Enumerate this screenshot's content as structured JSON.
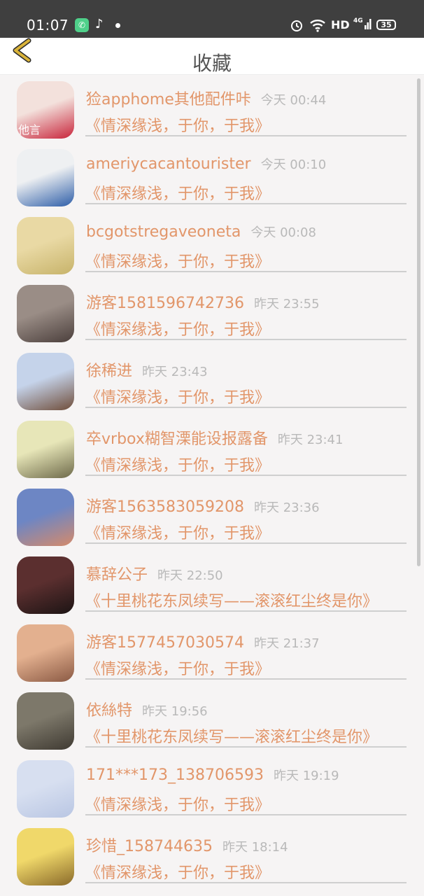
{
  "status_bar": {
    "time": "01:07",
    "network": "HD",
    "signal": "4G",
    "battery": "35"
  },
  "header": {
    "title": "收藏"
  },
  "favorites": [
    {
      "name": "猃apphome其他配件咔",
      "time": "今天 00:44",
      "message": "《情深缘浅，于你，于我》",
      "avatar_text": "他言",
      "avatar_colors": [
        "#f3e1dc",
        "#c8243a"
      ]
    },
    {
      "name": "ameriycacantourister",
      "time": "今天 00:10",
      "message": "《情深缘浅，于你，于我》",
      "avatar_text": "",
      "avatar_colors": [
        "#eef0f2",
        "#2e5ea8"
      ]
    },
    {
      "name": "bcgotstregaveoneta",
      "time": "今天 00:08",
      "message": "《情深缘浅，于你，于我》",
      "avatar_text": "",
      "avatar_colors": [
        "#e9d9a4",
        "#c7b36a"
      ]
    },
    {
      "name": "游客1581596742736",
      "time": "昨天 23:55",
      "message": "《情深缘浅，于你，于我》",
      "avatar_text": "",
      "avatar_colors": [
        "#9a8d86",
        "#4b3f3c"
      ]
    },
    {
      "name": "徐稀进",
      "time": "昨天 23:43",
      "message": "《情深缘浅，于你，于我》",
      "avatar_text": "",
      "avatar_colors": [
        "#c5d3ea",
        "#6f4d3a"
      ]
    },
    {
      "name": "卒vrbox糊智溧能设报露备",
      "time": "昨天 23:41",
      "message": "《情深缘浅，于你，于我》",
      "avatar_text": "",
      "avatar_colors": [
        "#e7e6b8",
        "#6e6a4a"
      ]
    },
    {
      "name": "游客1563583059208",
      "time": "昨天 23:36",
      "message": "《情深缘浅，于你，于我》",
      "avatar_text": "",
      "avatar_colors": [
        "#6d86c4",
        "#d58a6a"
      ]
    },
    {
      "name": "慕辞公子",
      "time": "昨天 22:50",
      "message": "《十里桃花东凤续写——滚滚红尘终是你》",
      "avatar_text": "",
      "avatar_colors": [
        "#5b2f2f",
        "#1c1414"
      ]
    },
    {
      "name": "游客1577457030574",
      "time": "昨天 21:37",
      "message": "《情深缘浅，于你，于我》",
      "avatar_text": "",
      "avatar_colors": [
        "#e3b08f",
        "#8b5a44"
      ]
    },
    {
      "name": "依絲特",
      "time": "昨天 19:56",
      "message": "《十里桃花东凤续写——滚滚红尘终是你》",
      "avatar_text": "",
      "avatar_colors": [
        "#7d786a",
        "#3f3a32"
      ]
    },
    {
      "name": "171***173_138706593",
      "time": "昨天 19:19",
      "message": "《情深缘浅，于你，于我》",
      "avatar_text": "",
      "avatar_colors": [
        "#d7dff0",
        "#b9c6e3"
      ]
    },
    {
      "name": "珍惜_158744635",
      "time": "昨天 18:14",
      "message": "《情深缘浅，于你，于我》",
      "avatar_text": "",
      "avatar_colors": [
        "#f0d86a",
        "#8a6a2a"
      ]
    }
  ],
  "colors": {
    "accent": "#e2966a",
    "time_gray": "#b9b9b9",
    "background": "#f6f4f4",
    "status_bar": "#3f3f3f",
    "back_arrow": "#d9b33a"
  }
}
